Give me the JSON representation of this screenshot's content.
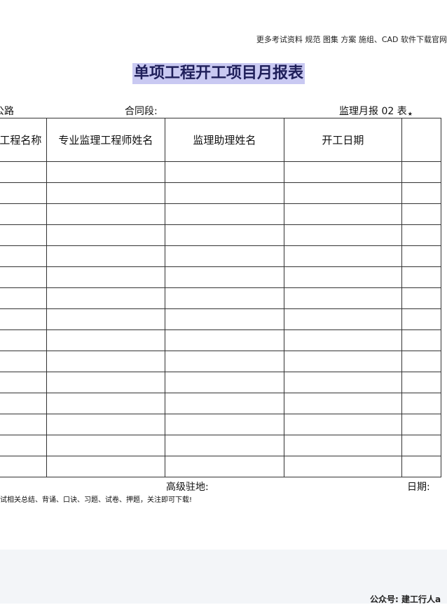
{
  "top_note": "更多考试资料 规范 图集 方案 施组、CAD 软件下载官网",
  "title": "单项工程开工项目月报表",
  "meta": {
    "left": "公路",
    "contract": "合同段:",
    "form_no": "监理月报 02 表"
  },
  "table": {
    "headers": [
      "工程名称",
      "专业监理工程师姓名",
      "监理助理姓名",
      "开工日期",
      ""
    ],
    "empty_rows": 15
  },
  "footer": {
    "note": "考试相关总结、背诵、口诀、习题、试卷、押题，关注即可下载!",
    "office": "高级驻地:",
    "date": "日期:"
  },
  "wechat": "公众号: 建工行人a"
}
